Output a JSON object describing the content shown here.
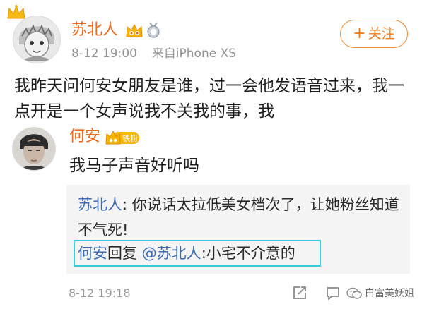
{
  "post": {
    "author": "苏北人",
    "timestamp": "8-12 19:00",
    "source": "来自iPhone XS",
    "follow_label": "关注",
    "follow_prefix": "+",
    "text": "我昨天问何安女朋友是谁，过一会他发语音过来，我一点开是一个女声说我不关我的事，我"
  },
  "comment": {
    "author": "何安",
    "fan_badge": "铁粉",
    "text": "我马子声音好听吗",
    "replies": [
      {
        "author": "苏北人",
        "separator": ":",
        "text": "你说话太拉低美女档次了，让她粉丝知道不气死!"
      },
      {
        "author": "何安",
        "reply_word": "回复",
        "mention": "@苏北人",
        "separator": ":",
        "text": "小宅不介意的"
      }
    ],
    "timestamp": "8-12 19:18"
  },
  "watermark": "白富美妖姐",
  "colors": {
    "name": "#e86b1f",
    "follow": "#f07c20",
    "link": "#3c6bb3",
    "highlight": "#35c9dc",
    "meta": "#939393",
    "reply_bg": "#f4f4f4"
  },
  "icons": {
    "crown": "crown-icon",
    "vip": "vip-badge-icon",
    "medal": "medal-icon",
    "share": "share-icon",
    "comment": "comment-icon",
    "wechat": "wechat-icon"
  }
}
